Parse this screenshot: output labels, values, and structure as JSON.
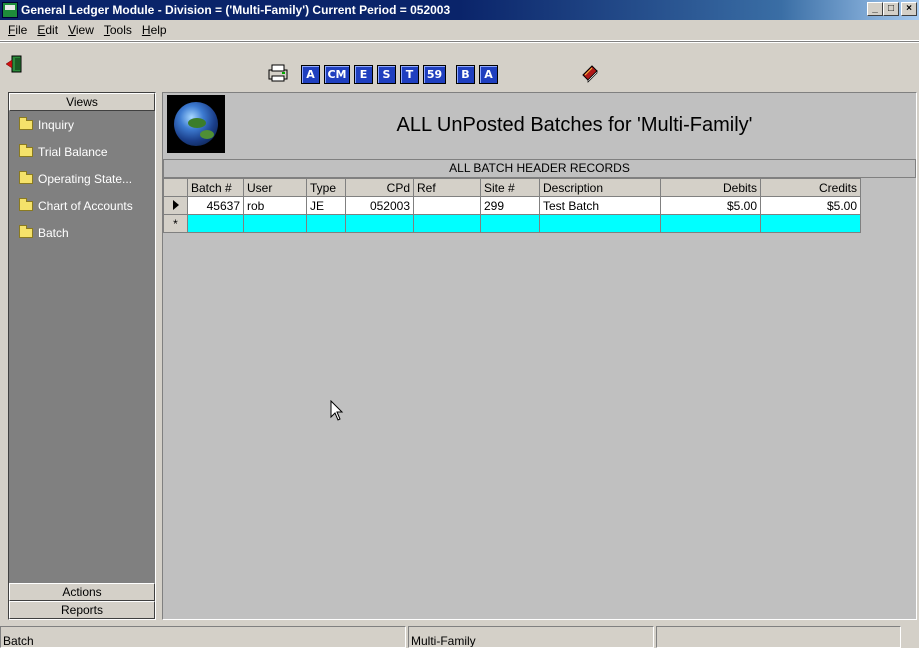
{
  "window": {
    "title": "General Ledger Module - Division = ('Multi-Family') Current Period = 052003",
    "min_label": "_",
    "max_label": "□",
    "close_label": "×"
  },
  "menu": [
    {
      "accel": "F",
      "rest": "ile"
    },
    {
      "accel": "E",
      "rest": "dit"
    },
    {
      "accel": "V",
      "rest": "iew"
    },
    {
      "accel": "T",
      "rest": "ools"
    },
    {
      "accel": "H",
      "rest": "elp"
    }
  ],
  "toolbar": {
    "buttons": [
      "A",
      "CM",
      "E",
      "S",
      "T",
      "59",
      "B",
      "A"
    ]
  },
  "sidebar": {
    "header": "Views",
    "items": [
      {
        "label": "Inquiry"
      },
      {
        "label": "Trial Balance"
      },
      {
        "label": "Operating State..."
      },
      {
        "label": "Chart of Accounts"
      },
      {
        "label": "Batch"
      }
    ],
    "actions": "Actions",
    "reports": "Reports"
  },
  "main": {
    "title": "ALL UnPosted Batches for 'Multi-Family'",
    "grid_caption": "ALL BATCH HEADER RECORDS",
    "columns": [
      "Batch #",
      "User",
      "Type",
      "CPd",
      "Ref",
      "Site #",
      "Description",
      "Debits",
      "Credits"
    ],
    "rows": [
      {
        "batch": "45637",
        "user": "rob",
        "type": "JE",
        "cpd": "052003",
        "ref": "",
        "site": "299",
        "description": "Test Batch",
        "debits": "$5.00",
        "credits": "$5.00"
      }
    ],
    "new_row_marker": "*"
  },
  "status": {
    "left": "Batch",
    "middle": "Multi-Family",
    "right": ""
  }
}
